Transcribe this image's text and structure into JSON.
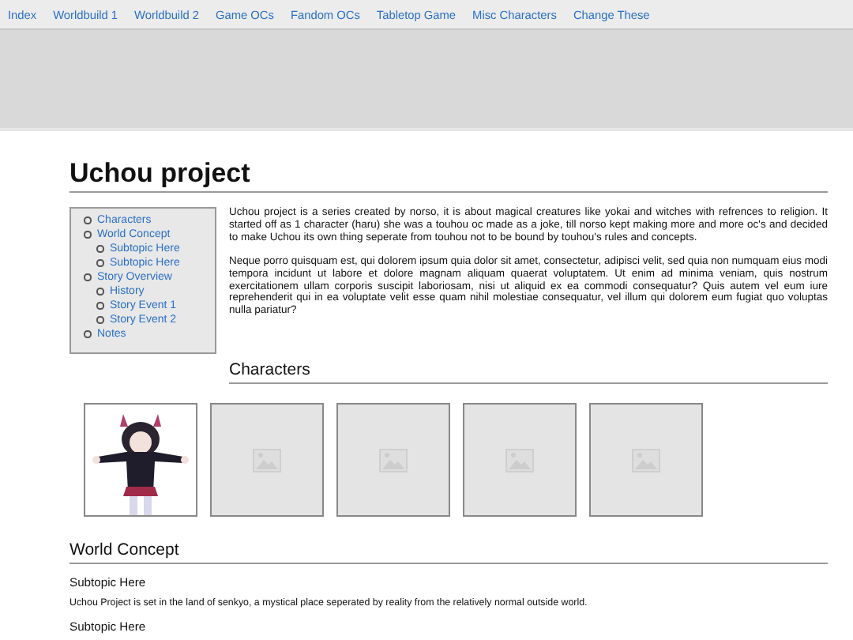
{
  "nav": [
    {
      "label": "Index"
    },
    {
      "label": "Worldbuild 1"
    },
    {
      "label": "Worldbuild 2"
    },
    {
      "label": "Game OCs"
    },
    {
      "label": "Fandom OCs"
    },
    {
      "label": "Tabletop Game"
    },
    {
      "label": "Misc Characters"
    },
    {
      "label": "Change These"
    }
  ],
  "title": "Uchou project",
  "toc": [
    {
      "label": "Characters"
    },
    {
      "label": "World Concept",
      "children": [
        {
          "label": "Subtopic Here"
        },
        {
          "label": "Subtopic Here"
        }
      ]
    },
    {
      "label": "Story Overview",
      "children": [
        {
          "label": "History"
        },
        {
          "label": "Story Event 1"
        },
        {
          "label": "Story Event 2"
        }
      ]
    },
    {
      "label": "Notes"
    }
  ],
  "intro": [
    "Uchou project is a series created by norso, it is about magical creatures like yokai and witches with refrences to religion. It started off as 1 character (haru) she was a touhou oc made as a joke, till norso kept making more and more oc's and decided to make Uchou its own thing seperate from touhou not to be bound by touhou's rules and concepts.",
    "Neque porro quisquam est, qui dolorem ipsum quia dolor sit amet, consectetur, adipisci velit, sed quia non numquam eius modi tempora incidunt ut labore et dolore magnam aliquam quaerat voluptatem. Ut enim ad minima veniam, quis nostrum exercitationem ullam corporis suscipit laboriosam, nisi ut aliquid ex ea commodi consequatur? Quis autem vel eum iure reprehenderit qui in ea voluptate velit esse quam nihil molestiae consequatur, vel illum qui dolorem eum fugiat quo voluptas nulla pariatur?"
  ],
  "characters": {
    "heading": "Characters",
    "gallery": [
      {
        "kind": "picture"
      },
      {
        "kind": "placeholder"
      },
      {
        "kind": "placeholder"
      },
      {
        "kind": "placeholder"
      },
      {
        "kind": "placeholder"
      }
    ]
  },
  "world": {
    "heading": "World Concept",
    "subtopics": [
      {
        "heading": "Subtopic Here",
        "text": "Uchou Project is set in the land of senkyo, a mystical place seperated by reality from the relatively normal outside world."
      },
      {
        "heading": "Subtopic Here"
      }
    ]
  }
}
